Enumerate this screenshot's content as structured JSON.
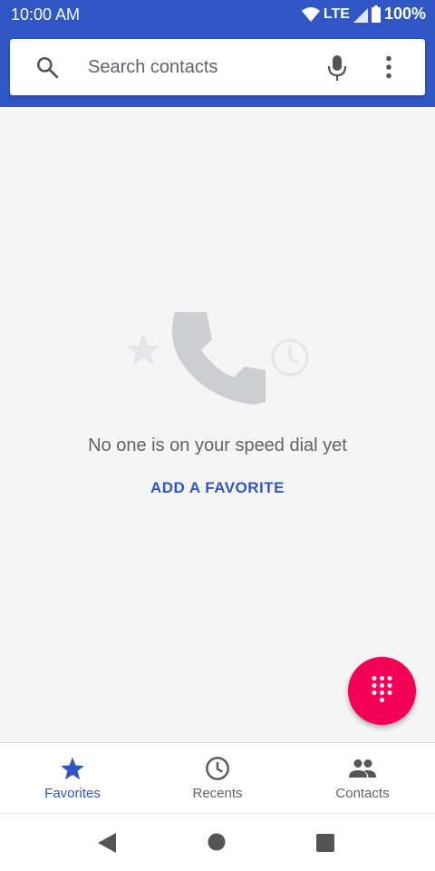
{
  "status_bar": {
    "time": "10:00 AM",
    "network": "LTE",
    "battery": "100%",
    "icons": [
      "wifi-icon",
      "signal-icon",
      "battery-icon"
    ]
  },
  "search": {
    "placeholder": "Search contacts",
    "icons": [
      "search-icon",
      "mic-icon",
      "more-vert-icon"
    ]
  },
  "empty_state": {
    "message": "No one is on your speed dial yet",
    "action_label": "ADD A FAVORITE",
    "icons": [
      "star-icon",
      "phone-icon",
      "clock-icon"
    ]
  },
  "fab": {
    "icon": "dialpad-icon",
    "color": "#f50057"
  },
  "bottom_nav": {
    "tabs": [
      {
        "label": "Favorites",
        "icon": "star-icon",
        "active": true
      },
      {
        "label": "Recents",
        "icon": "clock-icon",
        "active": false
      },
      {
        "label": "Contacts",
        "icon": "people-icon",
        "active": false
      }
    ]
  },
  "system_nav": {
    "icons": [
      "back-icon",
      "home-icon",
      "recents-icon"
    ]
  },
  "colors": {
    "primary": "#2f56c4",
    "accent": "#f50057",
    "background": "#f5f5f5",
    "muted_text": "#5f6368"
  }
}
